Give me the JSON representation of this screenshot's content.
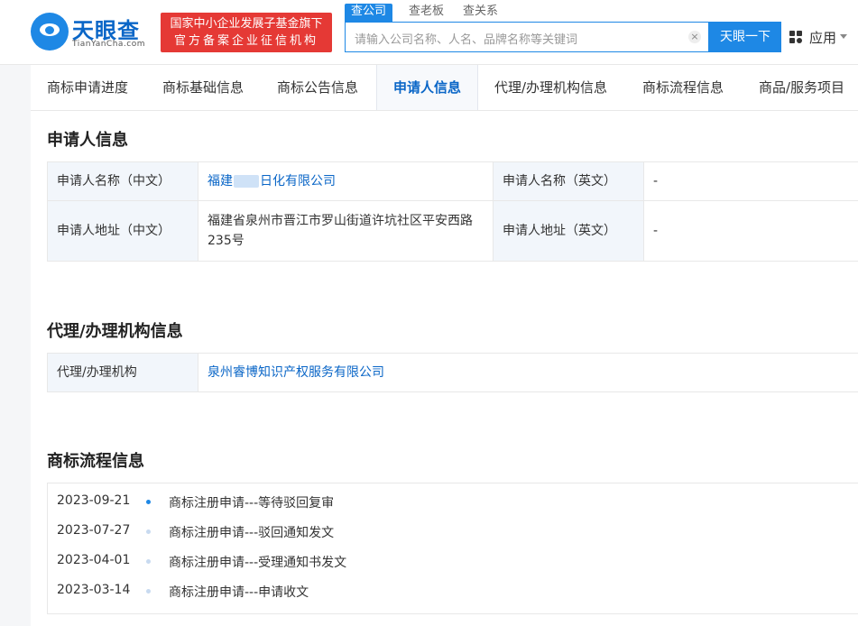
{
  "header": {
    "logo_title": "天眼查",
    "logo_sub": "TianYanCha.com",
    "badge_line1": "国家中小企业发展子基金旗下",
    "badge_line2": "官方备案企业征信机构",
    "search_tabs": [
      "查公司",
      "查老板",
      "查关系"
    ],
    "search_placeholder": "请输入公司名称、人名、品牌名称等关键词",
    "search_button": "天眼一下",
    "apps_label": "应用"
  },
  "tabs": [
    "商标申请进度",
    "商标基础信息",
    "商标公告信息",
    "申请人信息",
    "代理/办理机构信息",
    "商标流程信息",
    "商品/服务项目"
  ],
  "active_tab": "申请人信息",
  "applicant": {
    "title": "申请人信息",
    "name_cn_label": "申请人名称（中文）",
    "name_cn_prefix": "福建",
    "name_cn_suffix": "日化有限公司",
    "name_en_label": "申请人名称（英文）",
    "name_en_value": "-",
    "addr_cn_label": "申请人地址（中文）",
    "addr_cn_value": "福建省泉州市晋江市罗山街道许坑社区平安西路235号",
    "addr_en_label": "申请人地址（英文）",
    "addr_en_value": "-"
  },
  "agency": {
    "title": "代理/办理机构信息",
    "label": "代理/办理机构",
    "value": "泉州睿博知识产权服务有限公司"
  },
  "flow": {
    "title": "商标流程信息",
    "items": [
      {
        "date": "2023-09-21",
        "text": "商标注册申请---等待驳回复审"
      },
      {
        "date": "2023-07-27",
        "text": "商标注册申请---驳回通知发文"
      },
      {
        "date": "2023-04-01",
        "text": "商标注册申请---受理通知书发文"
      },
      {
        "date": "2023-03-14",
        "text": "商标注册申请---申请收文"
      }
    ]
  },
  "colors": {
    "brand": "#1e88e5",
    "link": "#0a66c7",
    "badge": "#e53935",
    "label_bg": "#f2f6fb"
  }
}
